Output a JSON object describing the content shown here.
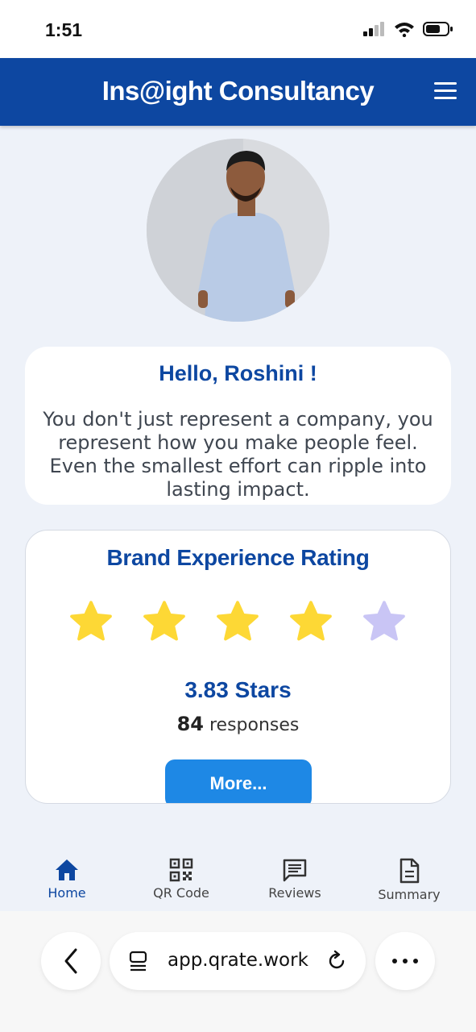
{
  "status_bar": {
    "time": "1:51",
    "icons": [
      "signal-icon",
      "wifi-icon",
      "battery-icon"
    ]
  },
  "header": {
    "title": "Ins@ight Consultancy",
    "menu_icon": "hamburger-menu-icon"
  },
  "profile": {
    "avatar": "profile-photo"
  },
  "greeting": {
    "title": "Hello, Roshini !",
    "message": "You don't just represent a company, you represent how you make people feel. Even the smallest effort can ripple into lasting impact."
  },
  "rating": {
    "title": "Brand Experience Rating",
    "stars_filled": 4,
    "stars_total": 5,
    "value_text": "3.83  Stars",
    "response_count": "84",
    "response_label": "responses",
    "more_button": "More...",
    "star_color": "#fdd835",
    "star_empty_color": "#c9c5f5"
  },
  "tabs": [
    {
      "label": "Home",
      "icon": "home-icon",
      "active": true
    },
    {
      "label": "QR Code",
      "icon": "qr-code-icon",
      "active": false
    },
    {
      "label": "Reviews",
      "icon": "chat-icon",
      "active": false
    },
    {
      "label": "Summary",
      "icon": "document-icon",
      "active": false
    }
  ],
  "browser": {
    "url": "app.qrate.work"
  },
  "colors": {
    "primary": "#0d47a1",
    "button": "#1e88e5",
    "background": "#eef2f9"
  }
}
